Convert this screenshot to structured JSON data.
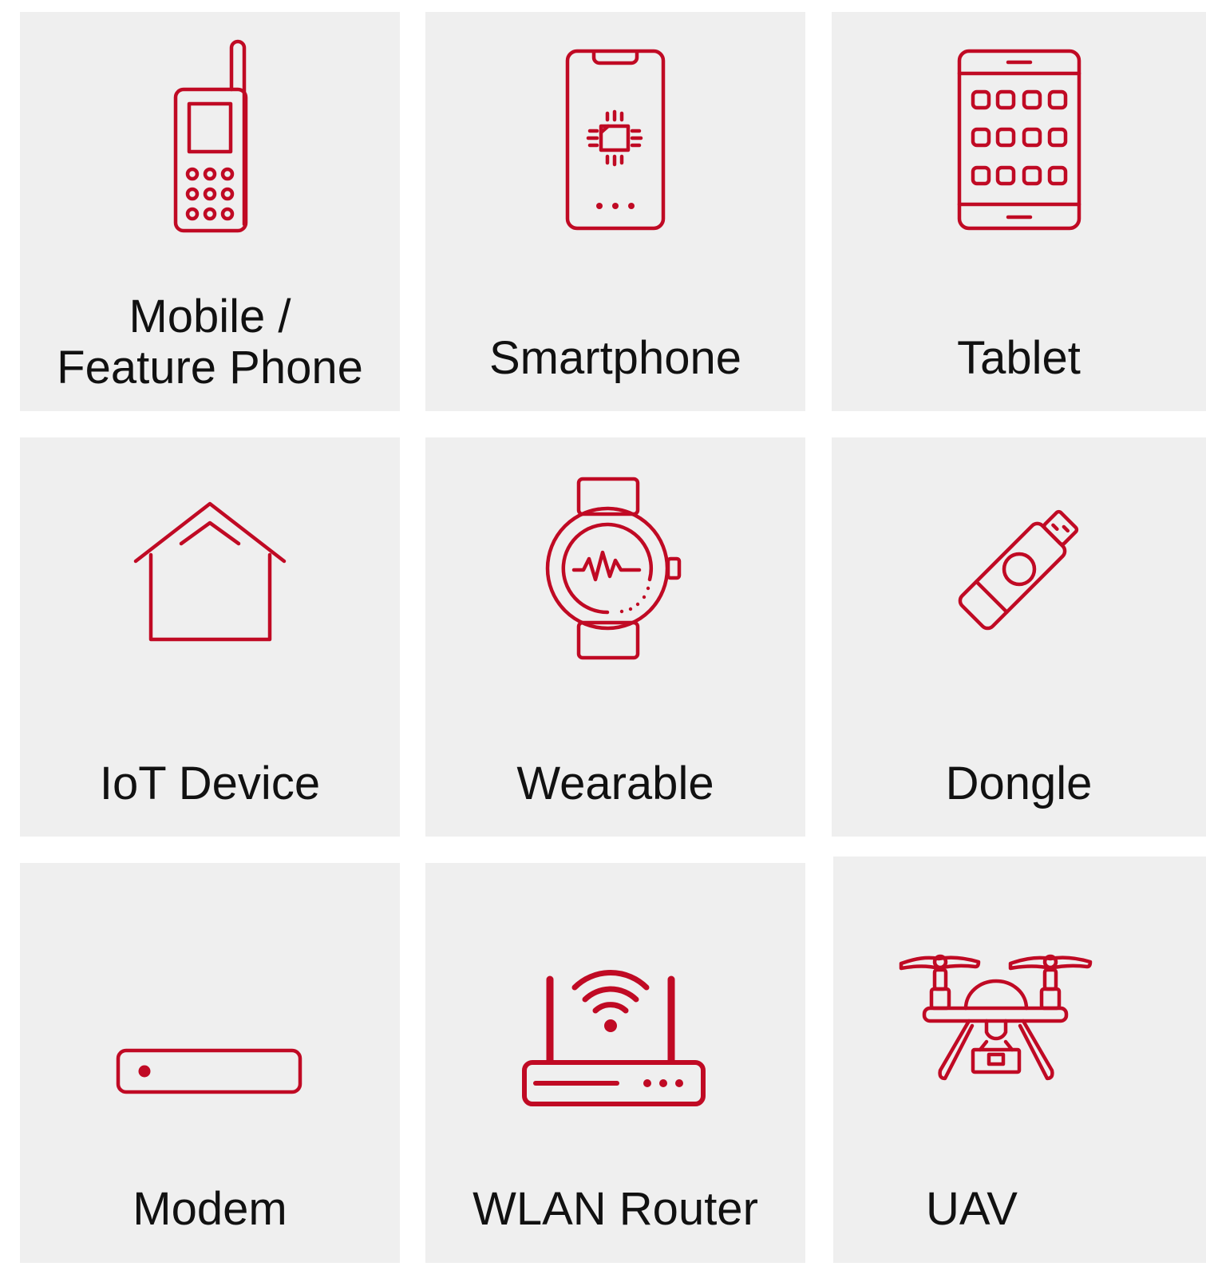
{
  "accent_color": "#c00a24",
  "tile_background": "#efefef",
  "tiles": [
    {
      "icon": "feature-phone-icon",
      "label_line1": "Mobile /",
      "label_line2": "Feature Phone"
    },
    {
      "icon": "smartphone-icon",
      "label": "Smartphone"
    },
    {
      "icon": "tablet-icon",
      "label": "Tablet"
    },
    {
      "icon": "house-icon",
      "label": "IoT Device"
    },
    {
      "icon": "smartwatch-icon",
      "label": "Wearable"
    },
    {
      "icon": "usb-dongle-icon",
      "label": "Dongle"
    },
    {
      "icon": "modem-icon",
      "label": "Modem"
    },
    {
      "icon": "wifi-router-icon",
      "label": "WLAN Router"
    },
    {
      "icon": "drone-icon",
      "label": "UAV"
    }
  ]
}
